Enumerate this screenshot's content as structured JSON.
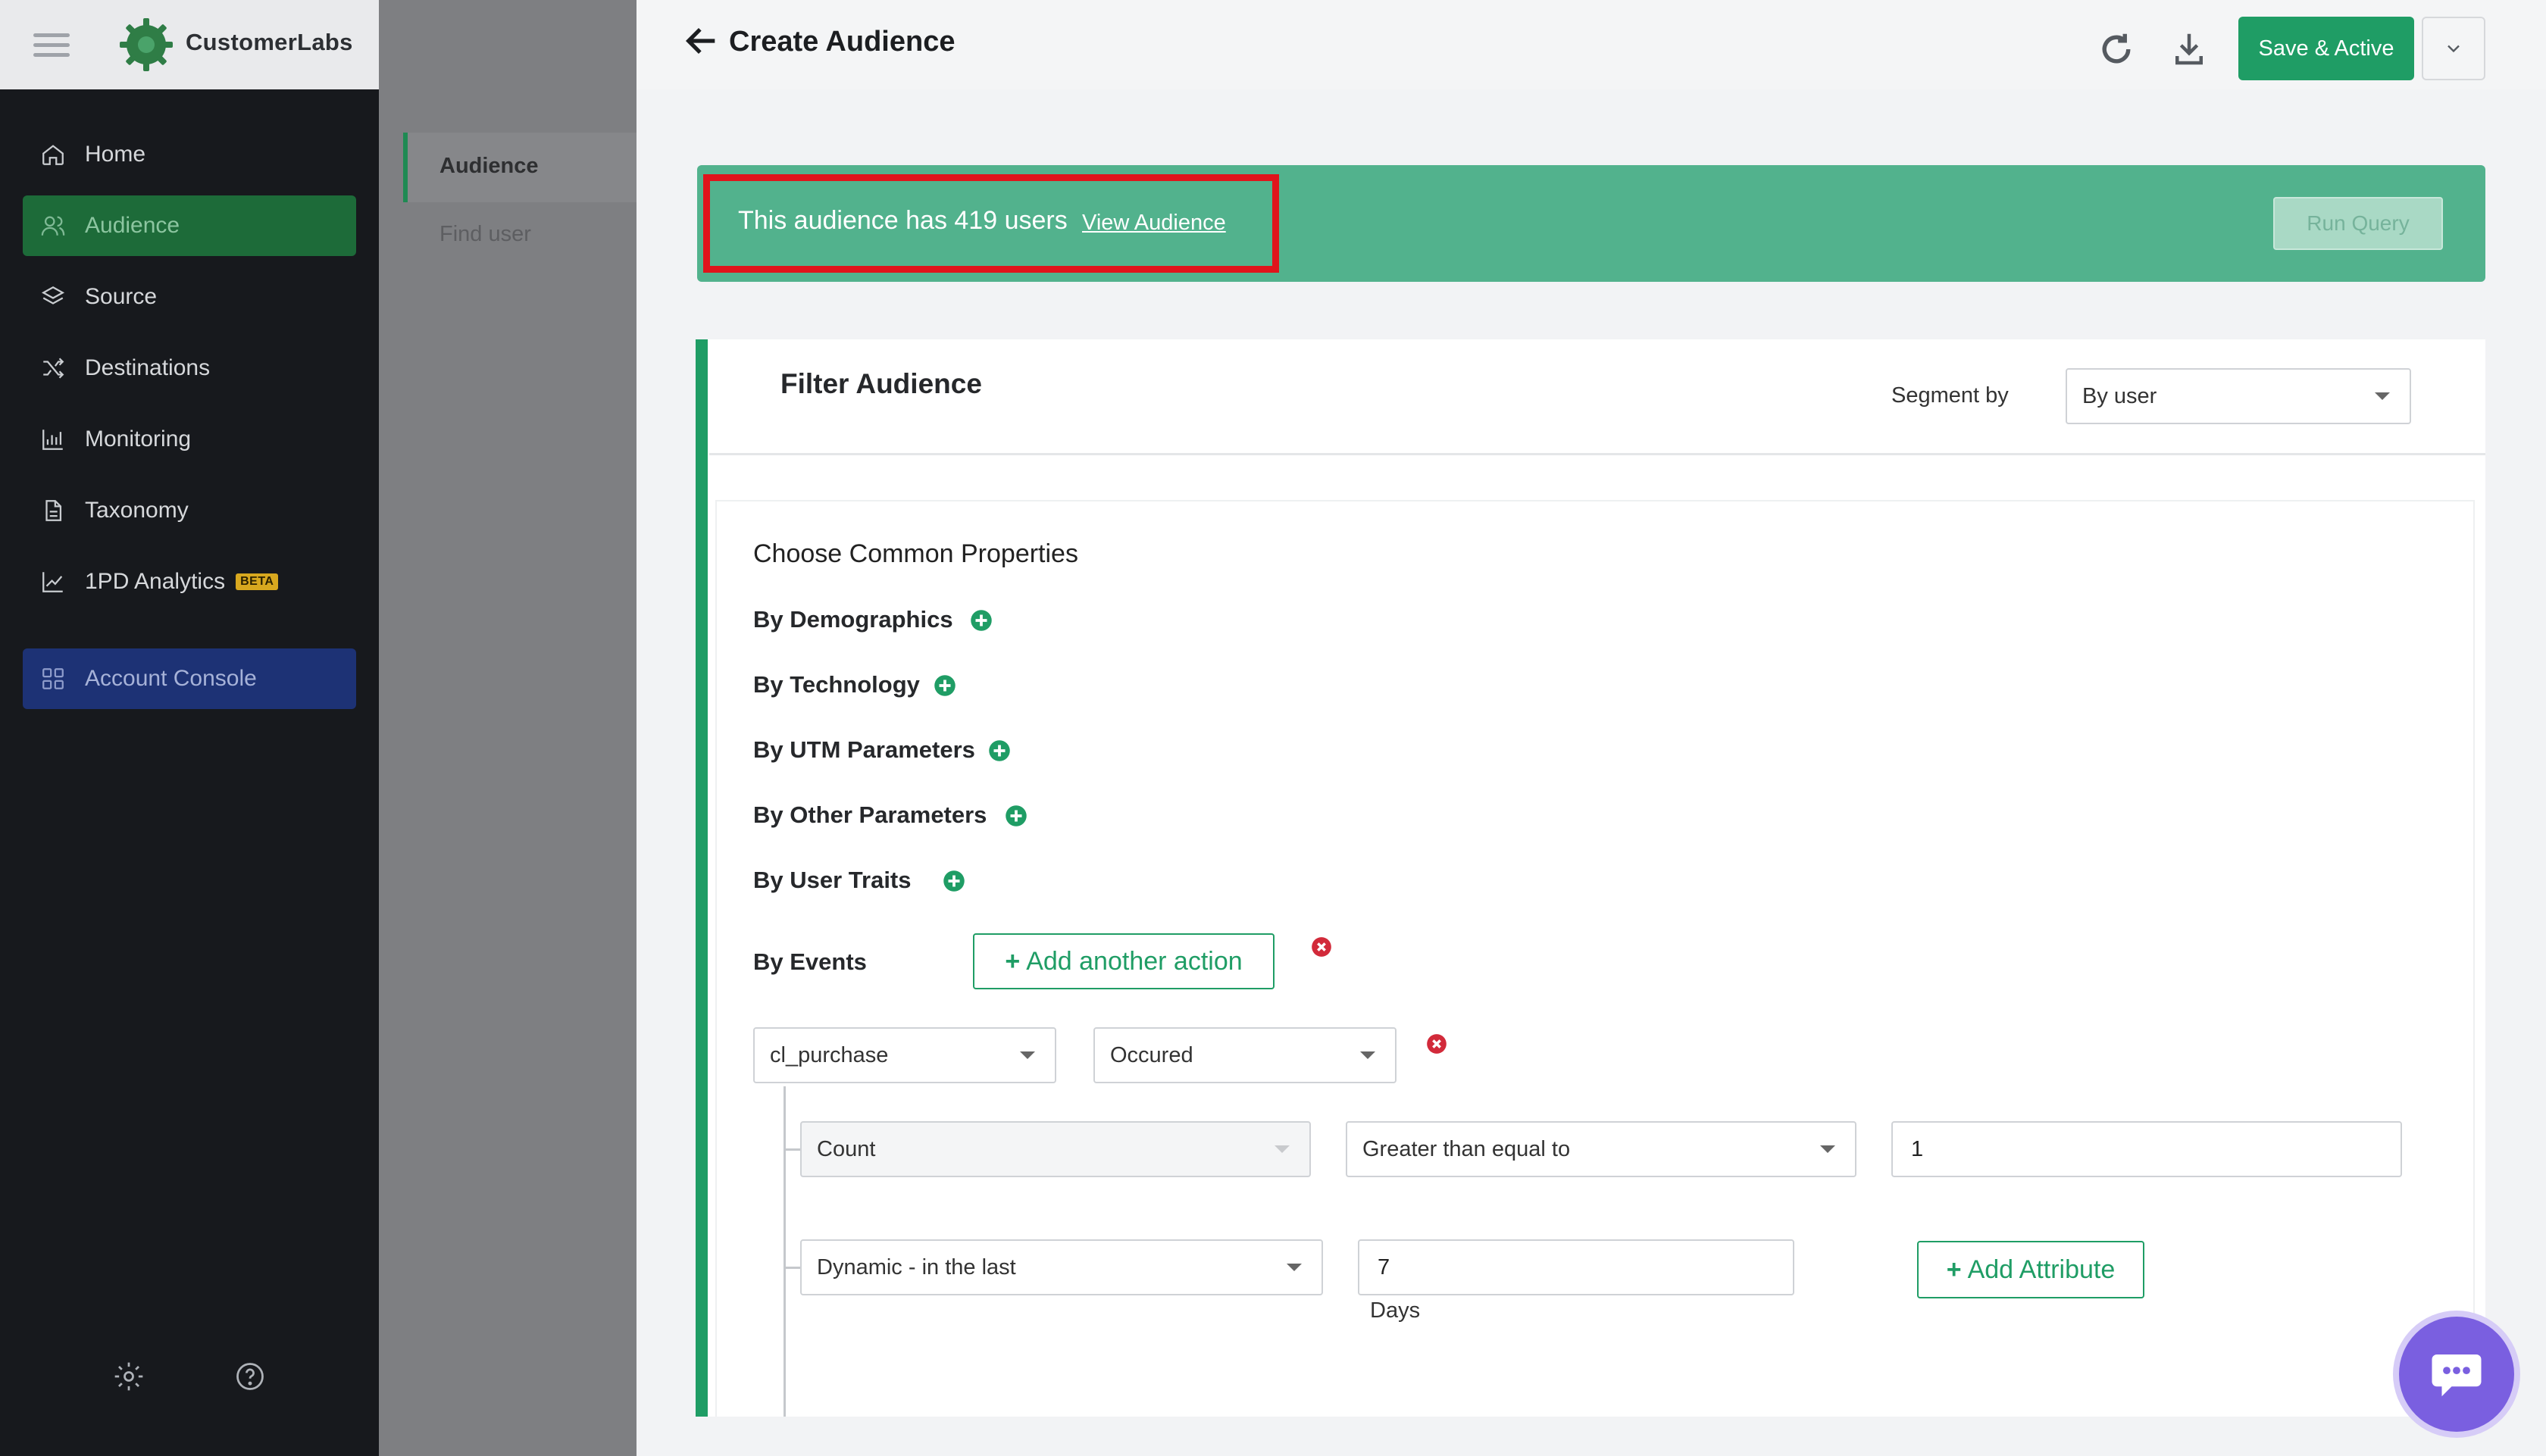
{
  "brand": {
    "name": "CustomerLabs"
  },
  "sidebar": {
    "items": [
      {
        "label": "Home",
        "icon": "home-icon"
      },
      {
        "label": "Audience",
        "icon": "users-icon",
        "active": true
      },
      {
        "label": "Source",
        "icon": "layers-icon"
      },
      {
        "label": "Destinations",
        "icon": "shuffle-icon"
      },
      {
        "label": "Monitoring",
        "icon": "bar-chart-icon"
      },
      {
        "label": "Taxonomy",
        "icon": "document-icon"
      },
      {
        "label": "1PD Analytics",
        "icon": "line-chart-icon",
        "badge": "BETA"
      },
      {
        "label": "Account Console",
        "icon": "grid-icon"
      }
    ],
    "footer_icons": [
      "gear-icon",
      "help-icon"
    ]
  },
  "subnav": {
    "items": [
      {
        "label": "Audience",
        "active": true
      },
      {
        "label": "Find user"
      }
    ]
  },
  "header": {
    "title": "Create Audience",
    "save_label": "Save & Active"
  },
  "banner": {
    "text": "This audience has 419 users",
    "link": "View Audience",
    "run_query": "Run Query",
    "color": "#52b28d",
    "highlight_color": "#e0141b"
  },
  "filter": {
    "title": "Filter Audience",
    "segment_label": "Segment by",
    "segment_value": "By user",
    "common_title": "Choose Common Properties",
    "properties": [
      "By Demographics",
      "By Technology",
      "By UTM Parameters",
      "By Other Parameters",
      "By User Traits"
    ],
    "events_label": "By Events",
    "add_action": "Add another action",
    "event": {
      "name": "cl_purchase",
      "occurrence": "Occured",
      "metric": "Count",
      "operator": "Greater than equal to",
      "value": "1",
      "time_mode": "Dynamic - in the last",
      "time_value": "7",
      "time_unit": "Days",
      "add_attribute": "Add Attribute"
    }
  },
  "colors": {
    "accent": "#1f9d65",
    "sidebar_bg": "#17191d",
    "active_nav": "#1d6b39",
    "console_nav": "#1d3275",
    "chat": "#7a5fe0"
  }
}
